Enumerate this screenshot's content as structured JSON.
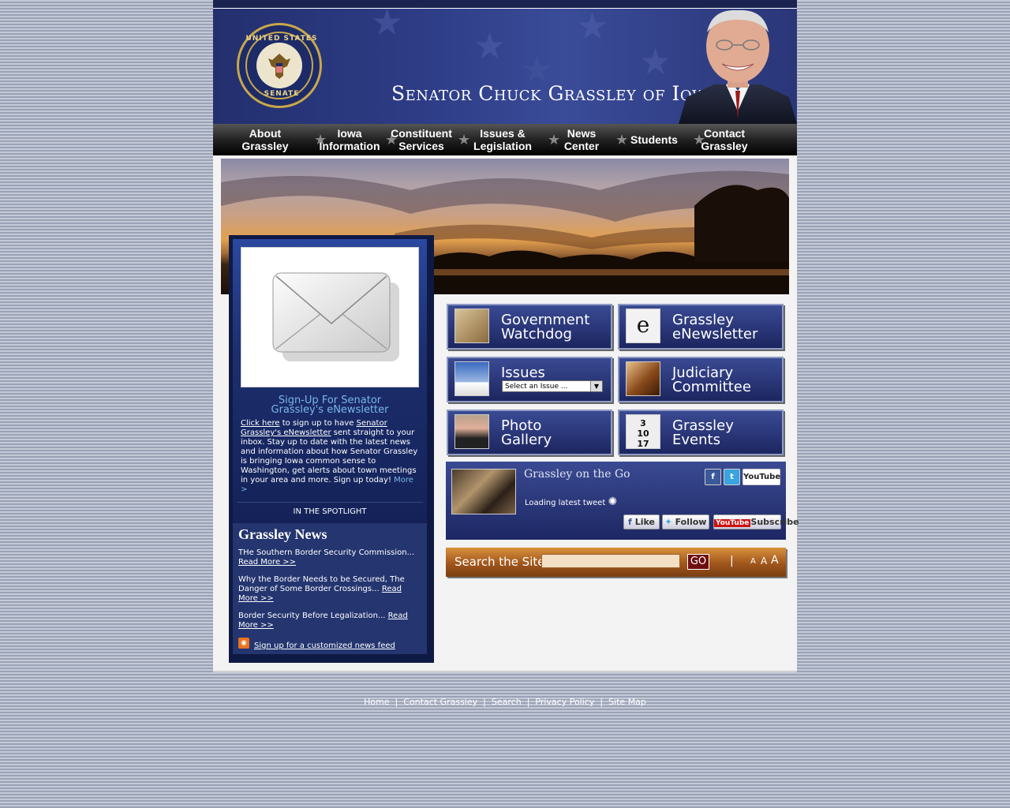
{
  "header": {
    "title": "Senator Chuck Grassley of Iowa",
    "seal_text_top": "UNITED STATES",
    "seal_text_bottom": "SENATE"
  },
  "nav": {
    "items": [
      {
        "line1": "About",
        "line2": "Grassley"
      },
      {
        "line1": "Iowa",
        "line2": "Information"
      },
      {
        "line1": "Constituent",
        "line2": "Services"
      },
      {
        "line1": "Issues &",
        "line2": "Legislation"
      },
      {
        "line1": "News",
        "line2": "Center"
      },
      {
        "line1": "Students",
        "line2": ""
      },
      {
        "line1": "Contact",
        "line2": "Grassley"
      }
    ],
    "separator": "★"
  },
  "signup": {
    "title_line1": "Sign-Up For Senator",
    "title_line2": "Grassley's eNewsletter",
    "click_here": "Click here",
    "text1": " to sign up to have ",
    "link2": "Senator Grassley's eNewsletter",
    "text2": " sent straight to your inbox. Stay up to date with the latest news and information about how Senator Grassley is bringing Iowa common sense to Washington, get alerts about town meetings in your area and more. Sign up today! ",
    "more": "More >"
  },
  "spotlight": {
    "label": "IN THE SPOTLIGHT"
  },
  "news": {
    "title": "Grassley News",
    "items": [
      {
        "text": "THe Southern Border Security Commission...",
        "link": "Read More >>"
      },
      {
        "text": "Why the Border Needs to be Secured, The Danger of Some Border Crossings...",
        "link": "Read More >>"
      },
      {
        "text": "Border Security Before Legalization...",
        "link": "Read More >>"
      }
    ],
    "rss_link": "Sign up for a customized news feed"
  },
  "tiles": {
    "watchdog": {
      "line1": "Government",
      "line2": "Watchdog"
    },
    "enewsletter": {
      "line1": "Grassley",
      "line2": "eNewsletter"
    },
    "issues": {
      "line1": "Issues",
      "select_placeholder": "Select an Issue ..."
    },
    "judiciary": {
      "line1": "Judiciary",
      "line2": "Committee"
    },
    "photo": {
      "line1": "Photo",
      "line2": "Gallery"
    },
    "events": {
      "line1": "Grassley",
      "line2": "Events"
    }
  },
  "onthego": {
    "title": "Grassley on the Go",
    "loading": "Loading latest tweet",
    "like": "Like",
    "follow": "Follow",
    "subscribe": "Subscribe",
    "youtube_text": "YouTube"
  },
  "search": {
    "label": "Search the Site",
    "go": "GO",
    "pipe": "|",
    "font_sizes": [
      "A",
      "A",
      "A"
    ]
  },
  "footer": {
    "links": [
      "Home",
      "Contact Grassley",
      "Search",
      "Privacy Policy",
      "Site Map"
    ],
    "separator": "|"
  },
  "colors": {
    "navy": "#2a3678",
    "nav_black": "#000000",
    "signup_blue": "#7ab6ea",
    "search_orange": "#c87a30",
    "page_bg": "#f3f3f3"
  }
}
